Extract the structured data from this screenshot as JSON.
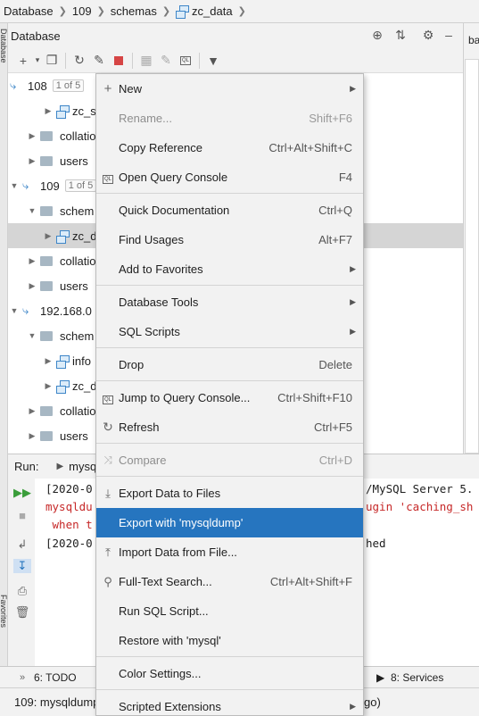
{
  "breadcrumb": [
    "Database",
    "109",
    "schemas",
    "zc_data"
  ],
  "db_panel": {
    "title": "Database"
  },
  "left_tabs": {
    "database": "Database",
    "favorites": "Favorites"
  },
  "right_tab": "ba",
  "tree": [
    {
      "label": "108",
      "badge": "1 of 5"
    },
    {
      "label": "zc_s"
    },
    {
      "label": "collatio"
    },
    {
      "label": "users"
    },
    {
      "label": "109",
      "badge": "1 of 5"
    },
    {
      "label": "schem"
    },
    {
      "label": "zc_d"
    },
    {
      "label": "collatio"
    },
    {
      "label": "users"
    },
    {
      "label": "192.168.0"
    },
    {
      "label": "schem"
    },
    {
      "label": "info"
    },
    {
      "label": "zc_d"
    },
    {
      "label": "collatio"
    },
    {
      "label": "users"
    }
  ],
  "run": {
    "label": "Run:",
    "tab": "mysq"
  },
  "console": [
    "[2020-0",
    "mysqldu",
    " when t",
    "[2020-0",
    "/MySQL Server 5.",
    "ugin 'caching_sh",
    "hed"
  ],
  "bottom_bar": {
    "todo": "6: TODO",
    "services": "8: Services"
  },
  "status": {
    "left": "109: mysqldump",
    "right": "go)"
  },
  "menu": {
    "items": [
      {
        "label": "New",
        "shortcut": "",
        "submenu": true
      },
      {
        "label": "Rename...",
        "shortcut": "Shift+F6",
        "disabled": true
      },
      {
        "label": "Copy Reference",
        "shortcut": "Ctrl+Alt+Shift+C"
      },
      {
        "label": "Open Query Console",
        "shortcut": "F4"
      },
      {
        "label": "Quick Documentation",
        "shortcut": "Ctrl+Q"
      },
      {
        "label": "Find Usages",
        "shortcut": "Alt+F7"
      },
      {
        "label": "Add to Favorites",
        "shortcut": "",
        "submenu": true
      },
      {
        "label": "Database Tools",
        "shortcut": "",
        "submenu": true
      },
      {
        "label": "SQL Scripts",
        "shortcut": "",
        "submenu": true
      },
      {
        "label": "Drop",
        "shortcut": "Delete"
      },
      {
        "label": "Jump to Query Console...",
        "shortcut": "Ctrl+Shift+F10"
      },
      {
        "label": "Refresh",
        "shortcut": "Ctrl+F5"
      },
      {
        "label": "Compare",
        "shortcut": "Ctrl+D",
        "disabled": true
      },
      {
        "label": "Export Data to Files",
        "shortcut": ""
      },
      {
        "label": "Export with 'mysqldump'",
        "shortcut": "",
        "highlighted": true
      },
      {
        "label": "Import Data from File...",
        "shortcut": ""
      },
      {
        "label": "Full-Text Search...",
        "shortcut": "Ctrl+Alt+Shift+F"
      },
      {
        "label": "Run SQL Script...",
        "shortcut": ""
      },
      {
        "label": "Restore with 'mysql'",
        "shortcut": ""
      },
      {
        "label": "Color Settings...",
        "shortcut": ""
      },
      {
        "label": "Scripted Extensions",
        "shortcut": "",
        "submenu": true
      }
    ]
  },
  "colors": {
    "highlight": "#2675bf",
    "selected_row": "#d5d5d5",
    "console_error": "#c62828",
    "accent_icon": "#3e86c8"
  }
}
